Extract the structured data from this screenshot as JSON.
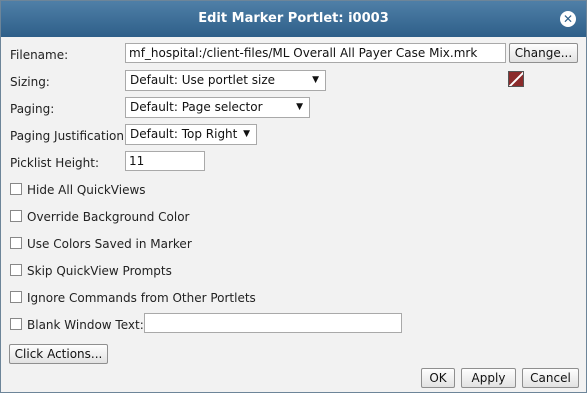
{
  "window": {
    "title": "Edit Marker Portlet: i0003",
    "close_glyph": "✕"
  },
  "filename": {
    "label": "Filename:",
    "value": "mf_hospital:/client-files/ML Overall All Payer Case Mix.mrk",
    "change_label": "Change..."
  },
  "sizing": {
    "label": "Sizing:",
    "value": "Default: Use portlet size",
    "color_chip": "#8b2b2b"
  },
  "paging": {
    "label": "Paging:",
    "value": "Default: Page selector"
  },
  "paging_justification": {
    "label": "Paging Justification:",
    "value": "Default: Top Right"
  },
  "picklist_height": {
    "label": "Picklist Height:",
    "value": "11"
  },
  "checkboxes": [
    {
      "label": "Hide All QuickViews",
      "checked": false
    },
    {
      "label": "Override Background Color",
      "checked": false
    },
    {
      "label": "Use Colors Saved in Marker",
      "checked": false
    },
    {
      "label": "Skip QuickView Prompts",
      "checked": false
    },
    {
      "label": "Ignore Commands from Other Portlets",
      "checked": false
    },
    {
      "label": "Blank Window Text:",
      "checked": false
    }
  ],
  "blank_window_text": {
    "value": ""
  },
  "buttons": {
    "click_actions": "Click Actions...",
    "ok": "OK",
    "apply": "Apply",
    "cancel": "Cancel"
  }
}
